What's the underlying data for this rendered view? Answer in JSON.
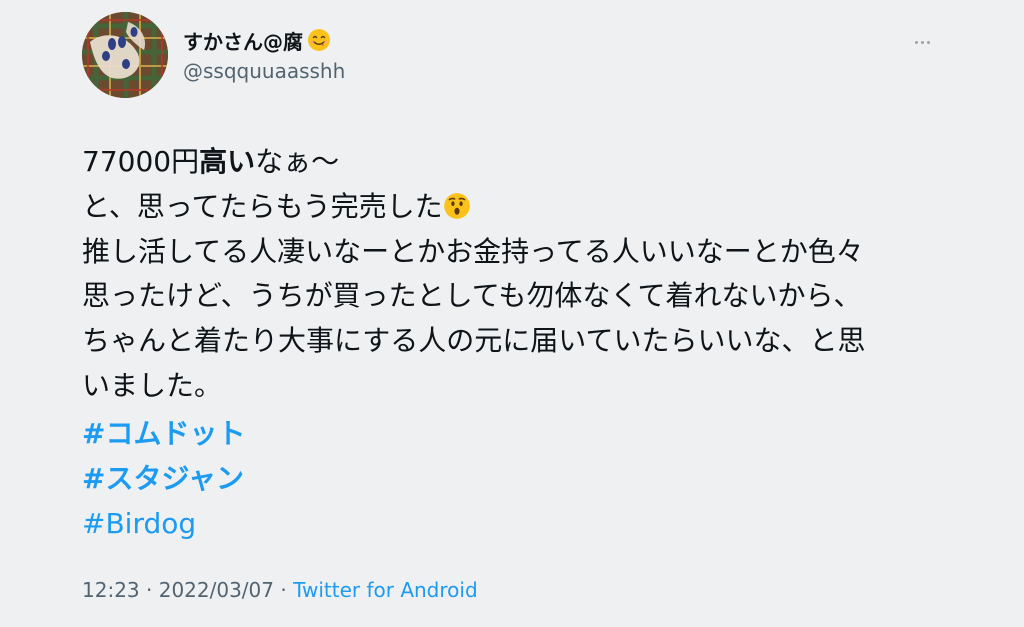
{
  "user": {
    "display_name": "すかさん@腐",
    "handle": "@ssqquuaasshh",
    "name_emoji": "smiling-face-savoring-food-emoji"
  },
  "tweet": {
    "line1_price": "77000円",
    "line1_bold": "高い",
    "line1_rest": "なぁ〜",
    "line2": "と、思ってたらもう完売した",
    "line2_emoji": "hushed-face-emoji",
    "line3": "推し活してる人凄いなーとかお金持ってる人いいなーとか色々",
    "line4": "思ったけど、うちが買ったとしても勿体なくて着れないから、",
    "line5": "ちゃんと着たり大事にする人の元に届いていたらいいな、と思",
    "line6": "いました。"
  },
  "hashtags": [
    "#コムドット",
    "#スタジャン",
    "#Birdog"
  ],
  "meta": {
    "time": "12:23",
    "separator": " · ",
    "date": "2022/03/07",
    "source": "Twitter for Android"
  },
  "colors": {
    "background": "#eef0f2",
    "text": "#0f1419",
    "secondary": "#536471",
    "link": "#1d9bf0"
  }
}
